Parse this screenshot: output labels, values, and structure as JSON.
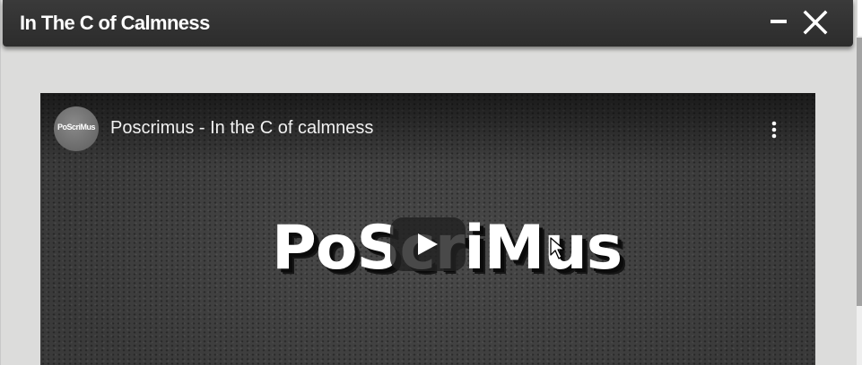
{
  "window": {
    "title": "In The C of Calmness",
    "minimize_icon": "minimize-icon",
    "close_icon": "close-icon"
  },
  "video": {
    "title": "Poscrimus - In the C of calmness",
    "channel_avatar_text": "PoScriMus",
    "logo_text": "PoScriMus",
    "more_icon": "more-vert-icon",
    "play_icon": "play-icon"
  },
  "colors": {
    "titlebar": "#2f2f2f",
    "window_background": "#dcdcdb",
    "play_button": "#212121"
  }
}
